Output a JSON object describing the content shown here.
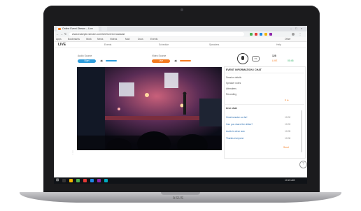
{
  "device": {
    "base_logo": "ASUS"
  },
  "browser": {
    "tab_title": "Online Event Stream – Live",
    "url": "www.example-stream.com/live/event-broadcast",
    "bookmarks": [
      "Apps",
      "Bookmarks",
      "Work",
      "News",
      "Videos",
      "Mail",
      "Docs",
      "Events",
      "Other"
    ]
  },
  "site": {
    "logo": "LIVE",
    "nav": [
      "Events",
      "Schedule",
      "Speakers",
      "Help"
    ]
  },
  "controls": {
    "left_label": "Audio Source",
    "left_pill": "Start",
    "mid_label": "Video Source",
    "mid_pill": "Live",
    "vs_label": "VS",
    "stats": [
      "128",
      "LIVE",
      "00:45"
    ]
  },
  "panel": {
    "title": "EVENT INFORMATION / CHAT",
    "rows": [
      "Session details",
      "Speaker notes",
      "Attendees",
      "Recording"
    ],
    "chat_title": "Live chat",
    "chat_rows": [
      "Great session so far!",
      "Can you share the slides?",
      "Audio is clear now",
      "Thanks everyone"
    ],
    "times": [
      "10:02",
      "10:03",
      "10:05",
      "10:06"
    ],
    "send": "Send"
  },
  "taskbar": {
    "tray": "10:24 AM"
  },
  "colors": {
    "accent_blue": "#2d9cdb",
    "accent_orange": "#f47b20",
    "accent_green": "#27ae60"
  }
}
